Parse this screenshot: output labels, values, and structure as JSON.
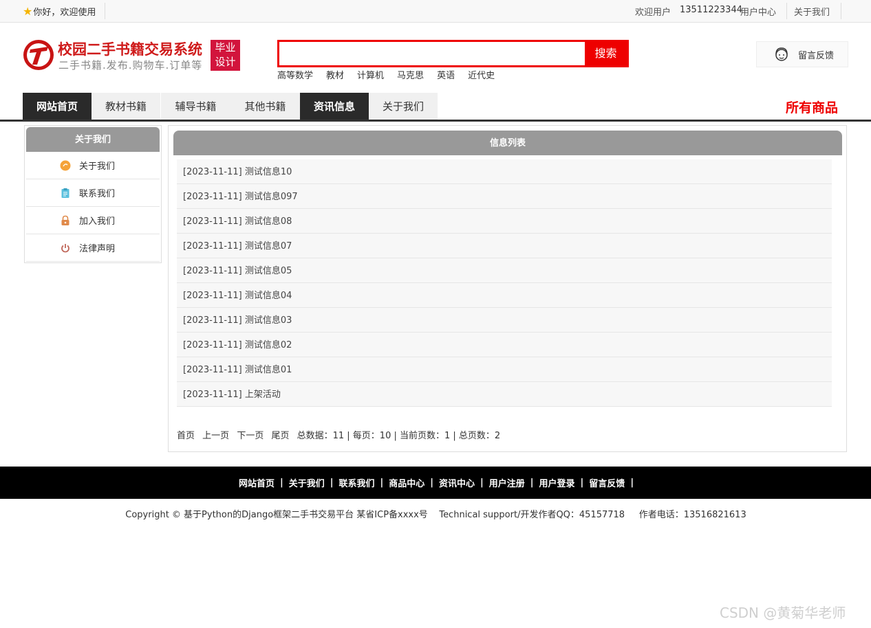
{
  "topbar": {
    "welcome": "你好，欢迎使用",
    "user_welcome": "欢迎用户",
    "phone": "13511223344",
    "user_center": "用户中心",
    "about": "关于我们"
  },
  "header": {
    "title": "校园二手书籍交易系统",
    "subtitle": "二手书籍.发布.购物车.订单等",
    "badge_line1": "毕业",
    "badge_line2": "设计",
    "search_button": "搜索",
    "search_value": "",
    "hot_words": [
      "高等数学",
      "教材",
      "计算机",
      "马克思",
      "英语",
      "近代史"
    ],
    "feedback": "留言反馈"
  },
  "nav": {
    "items": [
      "网站首页",
      "教材书籍",
      "辅导书籍",
      "其他书籍",
      "资讯信息",
      "关于我们"
    ],
    "all_goods": "所有商品"
  },
  "sidebar": {
    "title": "关于我们",
    "items": [
      {
        "label": "关于我们",
        "icon": "orange-circle-icon"
      },
      {
        "label": "联系我们",
        "icon": "clipboard-icon"
      },
      {
        "label": "加入我们",
        "icon": "lock-icon"
      },
      {
        "label": "法律声明",
        "icon": "power-icon"
      }
    ]
  },
  "content": {
    "title": "信息列表",
    "rows": [
      "[2023-11-11] 测试信息10",
      "[2023-11-11] 测试信息097",
      "[2023-11-11] 测试信息08",
      "[2023-11-11] 测试信息07",
      "[2023-11-11] 测试信息05",
      "[2023-11-11] 测试信息04",
      "[2023-11-11] 测试信息03",
      "[2023-11-11] 测试信息02",
      "[2023-11-11] 测试信息01",
      "[2023-11-11] 上架活动"
    ],
    "pager": {
      "first": "首页",
      "prev": "上一页",
      "next": "下一页",
      "last": "尾页",
      "summary": "总数据：11 | 每页：10 | 当前页数：1 | 总页数：2"
    }
  },
  "footer": {
    "links": [
      "网站首页",
      "关于我们",
      "联系我们",
      "商品中心",
      "资讯中心",
      "用户注册",
      "用户登录",
      "留言反馈"
    ],
    "copyright": "Copyright © 基于Python的Django框架二手书交易平台 某省ICP备xxxx号    Technical support/开发作者QQ：45157718     作者电话：13516821613"
  },
  "watermark": "CSDN @黄菊华老师",
  "colors": {
    "accent_red": "#e00000",
    "nav_dark": "#2a2a2a",
    "panel_header": "#999999"
  }
}
